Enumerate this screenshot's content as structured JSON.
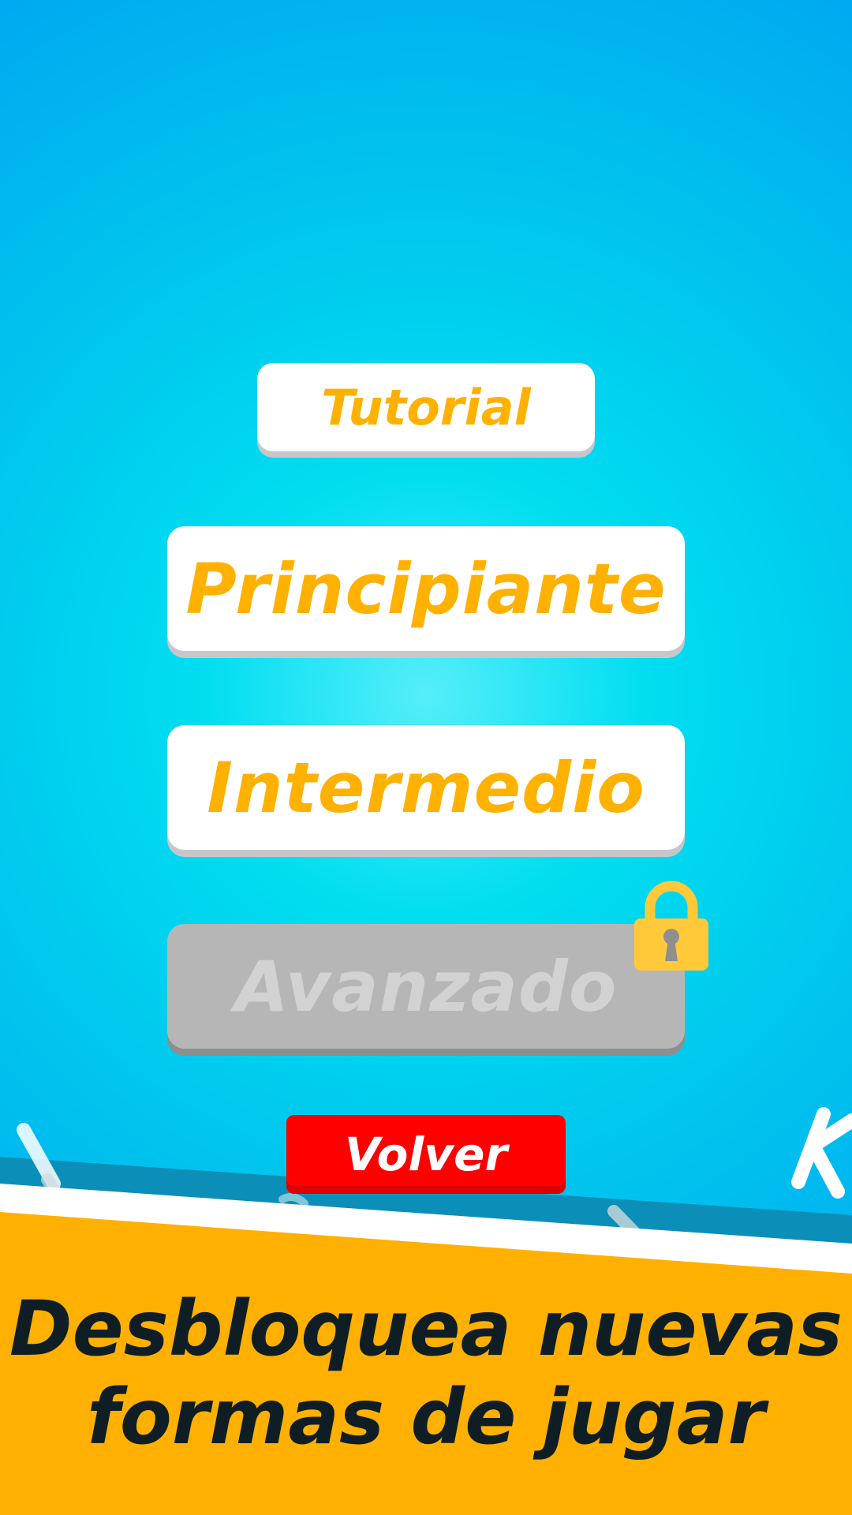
{
  "menu": {
    "tutorial": "Tutorial",
    "principiante": "Principiante",
    "intermedio": "Intermedio",
    "avanzado": "Avanzado",
    "avanzado_locked": true,
    "back": "Volver"
  },
  "promo": {
    "line1": "Desbloquea nuevas",
    "line2": "formas de jugar"
  },
  "colors": {
    "button_text": "#ffb100",
    "button_bg": "#ffffff",
    "locked_bg": "#b6b6b6",
    "locked_text": "#d2d2d2",
    "back_bg": "#ff0000",
    "back_text": "#ffffff",
    "lock": "#ffc93a",
    "banner": "#ffb000",
    "banner_text": "#0f1e24"
  },
  "icons": {
    "lock": "padlock-icon"
  }
}
